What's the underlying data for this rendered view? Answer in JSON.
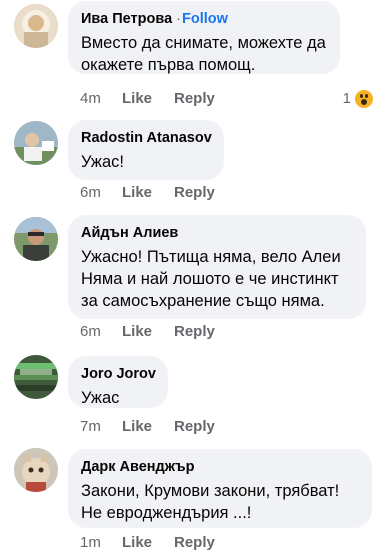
{
  "comments": [
    {
      "author": "Ива Петрова",
      "separator": "·",
      "follow_label": "Follow",
      "lines": [
        "Вместо да снимате, можехте да",
        "окажете първа помощ."
      ],
      "time": "4m",
      "like_label": "Like",
      "reply_label": "Reply",
      "reaction_count": "1"
    },
    {
      "author": "Radostin Atanasov",
      "lines": [
        "Ужас!"
      ],
      "time": "6m",
      "like_label": "Like",
      "reply_label": "Reply"
    },
    {
      "author": "Айдън Алиев",
      "lines": [
        "Ужасно! Пътища няма, вело Алеи",
        "Няма и най лошото е че инстинкт",
        "за самосъхранение също няма."
      ],
      "time": "6m",
      "like_label": "Like",
      "reply_label": "Reply"
    },
    {
      "author": "Joro Jorov",
      "lines": [
        "Ужас"
      ],
      "time": "7m",
      "like_label": "Like",
      "reply_label": "Reply"
    },
    {
      "author": "Дарк Авенджър",
      "lines": [
        "Закони, Крумови закони, трябват!",
        "Не евроджендърия ...!"
      ],
      "time": "1m",
      "like_label": "Like",
      "reply_label": "Reply"
    }
  ],
  "colors": {
    "bubble": "#f0f2f5",
    "link": "#1877f2",
    "meta": "#65676b",
    "text": "#050505",
    "wow_reaction": "#f7b125"
  },
  "icons": [
    "wow-reaction-icon"
  ]
}
